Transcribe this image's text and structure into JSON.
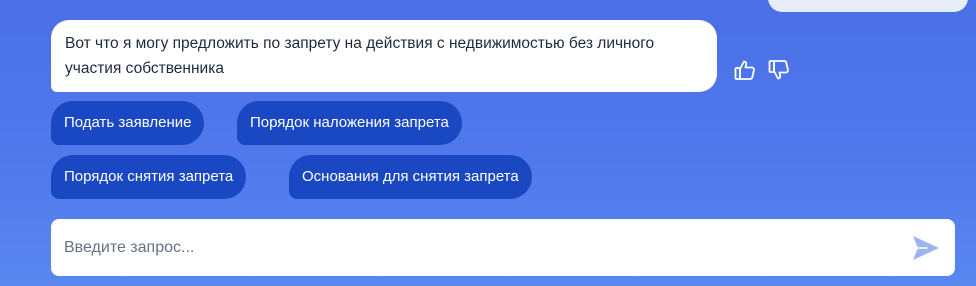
{
  "chat": {
    "bot_message": "Вот что я могу предложить по запрету на действия с недвижимостью без личного участия собственника",
    "feedback": {
      "like_icon": "thumbs-up-icon",
      "dislike_icon": "thumbs-down-icon"
    },
    "suggestions": [
      "Подать заявление",
      "Порядок наложения запрета",
      "Порядок снятия запрета",
      "Основания для снятия запрета"
    ]
  },
  "input": {
    "placeholder": "Введите запрос...",
    "value": "",
    "send_icon": "send-icon"
  },
  "colors": {
    "background": "#4f77ea",
    "chip": "#1a48c3",
    "send_icon": "#9db3f0"
  }
}
